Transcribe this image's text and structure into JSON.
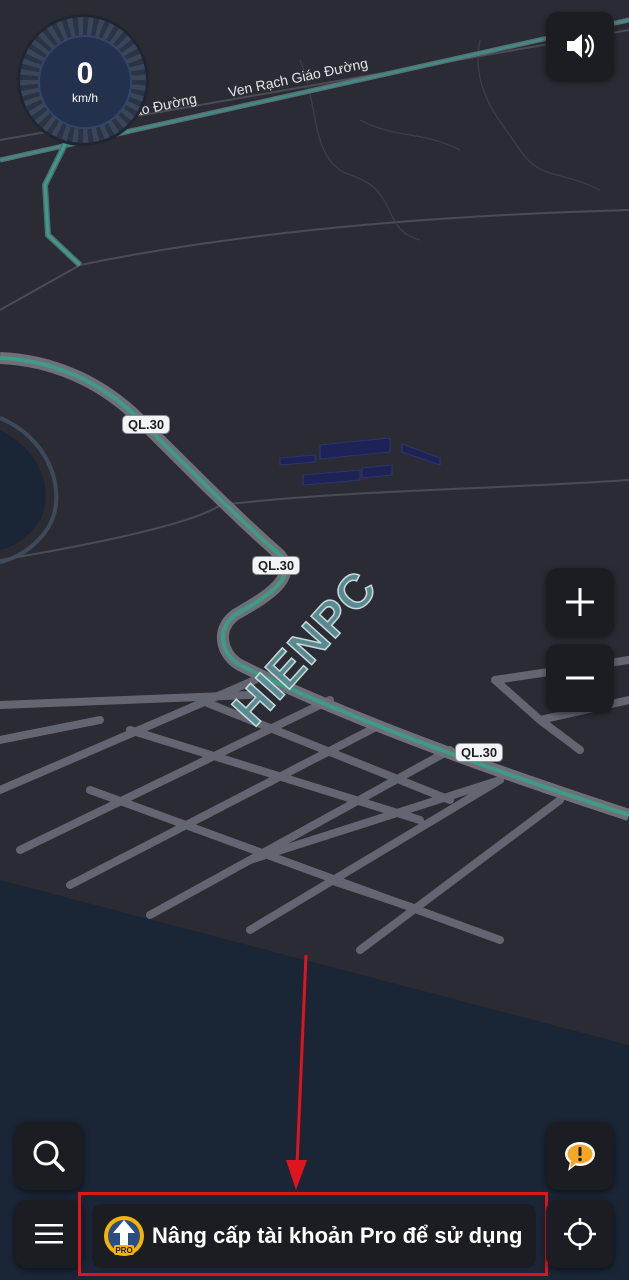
{
  "speedometer": {
    "value": "0",
    "unit": "km/h"
  },
  "map": {
    "street_labels": [
      "Ven Rạch Giáo Đường",
      "Giáo Đường"
    ],
    "route_shields": [
      "QL.30",
      "QL.30",
      "QL.30"
    ],
    "watermark": "HIENPC"
  },
  "controls": {
    "sound_icon": "speaker-volume-icon",
    "zoom_in_icon": "plus-icon",
    "zoom_out_icon": "minus-icon",
    "search_icon": "search-icon",
    "report_icon": "chat-alert-icon",
    "menu_icon": "hamburger-menu-icon",
    "locate_icon": "crosshair-icon"
  },
  "upgrade": {
    "label": "Nâng cấp tài khoản Pro để sử dụng",
    "badge_text": "PRO"
  },
  "colors": {
    "route": "#3f9a86",
    "road": "#636671",
    "map_background": "#2b2b33",
    "water": "#1a2535",
    "highlight": "#e0141d",
    "pro_badge": "#f5b400"
  }
}
